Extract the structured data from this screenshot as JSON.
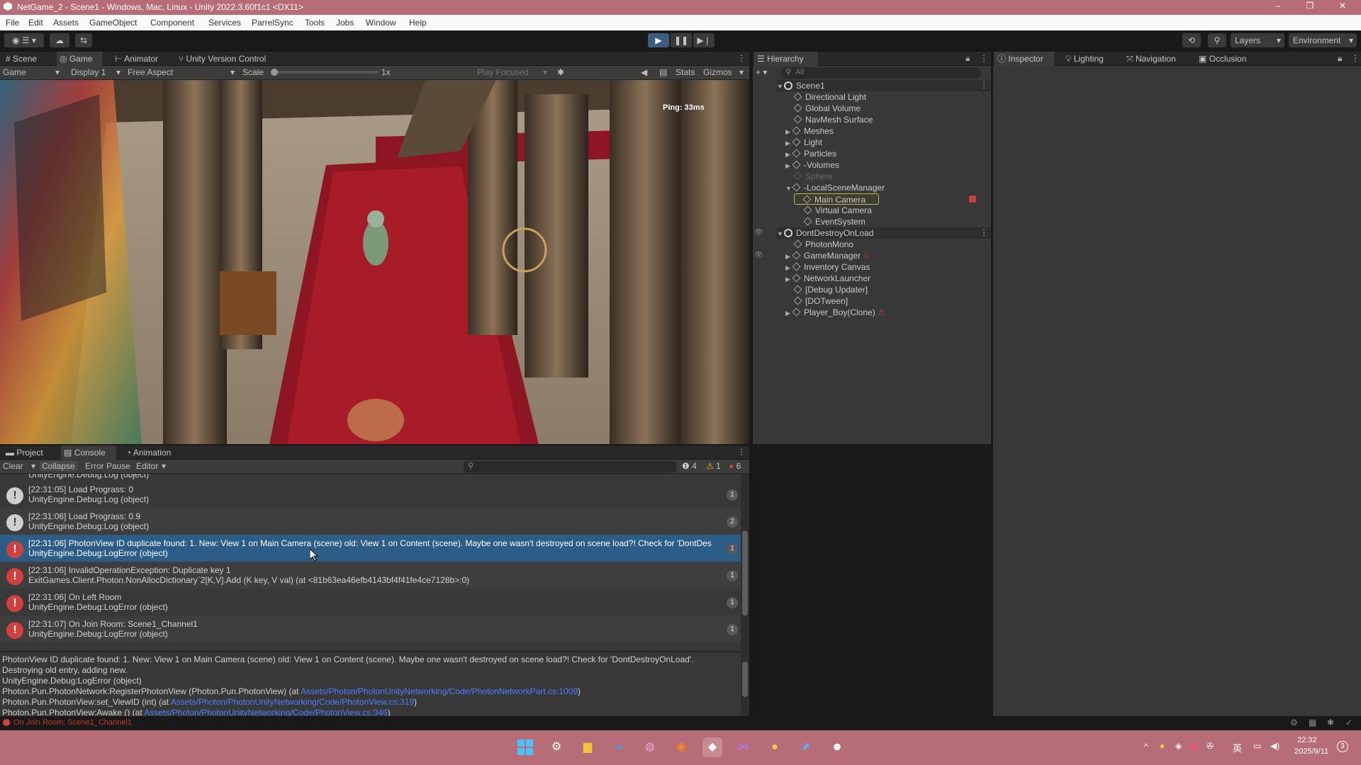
{
  "window": {
    "title": "NetGame_2 - Scene1 - Windows, Mac, Linux - Unity 2022.3.60f1c1 <DX11>",
    "min": "–",
    "max": "❐",
    "close": "✕"
  },
  "menu": [
    "File",
    "Edit",
    "Assets",
    "GameObject",
    "Component",
    "Services",
    "ParrelSync",
    "Tools",
    "Jobs",
    "Window",
    "Help"
  ],
  "toolbar": {
    "layers": "Layers",
    "environment": "Environment"
  },
  "game_panel": {
    "tabs": [
      "Scene",
      "Game",
      "Animator",
      "Unity Version Control"
    ],
    "game_label": "Game",
    "display": "Display 1",
    "aspect": "Free Aspect",
    "scale_label": "Scale",
    "scale_value": "1x",
    "play_mode": "Play Focused",
    "stats": "Stats",
    "gizmos": "Gizmos",
    "ping": "Ping: 33ms"
  },
  "hierarchy": {
    "tab": "Hierarchy",
    "search_placeholder": "All",
    "items": [
      "Scene1",
      "Directional Light",
      "Global Volume",
      "NavMesh Surface",
      "Meshes",
      "Light",
      "Particles",
      "-Volumes",
      "Sphere",
      "-LocalSceneManager",
      "Main Camera",
      "Virtual Camera",
      "EventSystem",
      "DontDestroyOnLoad",
      "PhotonMono",
      "GameManager",
      "Inventory Canvas",
      "NetworkLauncher",
      "[Debug Updater]",
      "[DOTween]",
      "Player_Boy(Clone)"
    ]
  },
  "inspector_tabs": [
    "Inspector",
    "Lighting",
    "Navigation",
    "Occlusion"
  ],
  "bottom_tabs": [
    "Project",
    "Console",
    "Animation"
  ],
  "console": {
    "clear": "Clear",
    "collapse": "Collapse",
    "error_pause": "Error Pause",
    "editor": "Editor",
    "log_count": "4",
    "warn_count": "1",
    "err_count": "6",
    "clipped_top": "UnityEngine.Debug:Log (object)",
    "entries": [
      {
        "l1": "[22:31:05] Load Prograss: 0",
        "l2": "UnityEngine.Debug:Log (object)",
        "count": "1"
      },
      {
        "l1": "[22:31:06] Load Prograss: 0.9",
        "l2": "UnityEngine.Debug:Log (object)",
        "count": "2"
      },
      {
        "l1": "[22:31:06] PhotonView ID duplicate found: 1. New: View 1 on Main Camera (scene) old: View 1 on Content (scene). Maybe one wasn't destroyed on scene load?! Check for 'DontDes",
        "l2": "UnityEngine.Debug:LogError (object)",
        "count": "1"
      },
      {
        "l1": "[22:31:06] InvalidOperationException: Duplicate key 1",
        "l2": "ExitGames.Client.Photon.NonAllocDictionary`2[K,V].Add (K key, V val) (at <81b63ea46efb4143bf4f41fe4ce7128b>:0)",
        "count": "1"
      },
      {
        "l1": "[22:31:06] On Left Room",
        "l2": "UnityEngine.Debug:LogError (object)",
        "count": "1"
      },
      {
        "l1": "[22:31:07] On Join Room: Scene1_Channel1",
        "l2": "UnityEngine.Debug:LogError (object)",
        "count": "1"
      }
    ],
    "detail": {
      "line1": "PhotonView ID duplicate found: 1. New: View 1 on Main Camera (scene) old: View 1 on Content (scene). Maybe one wasn't destroyed on scene load?! Check for 'DontDestroyOnLoad'.",
      "line2": "Destroying old entry, adding new.",
      "line3": "UnityEngine.Debug:LogError (object)",
      "line4_pre": "Photon.Pun.PhotonNetwork:RegisterPhotonView (Photon.Pun.PhotonView) (at ",
      "line4_link": "Assets/Photon/PhotonUnityNetworking/Code/PhotonNetworkPart.cs:1009",
      "line4_post": ")",
      "line5_pre": "Photon.Pun.PhotonView:set_ViewID (int) (at ",
      "line5_link": "Assets/Photon/PhotonUnityNetworking/Code/PhotonView.cs:319",
      "line5_post": ")",
      "line6_pre": "Photon.Pun.PhotonView:Awake () (at ",
      "line6_link": "Assets/Photon/PhotonUnityNetworking/Code/PhotonView.cs:346",
      "line6_post": ")"
    }
  },
  "statusbar": {
    "message": "On Join Room: Scene1_Channel1"
  },
  "taskbar": {
    "ime": "英",
    "time": "22:32",
    "date": "2025/9/11",
    "notif": "3"
  },
  "colors": {
    "title": "#b76d77",
    "error": "#d23f3f",
    "link": "#4c7eff",
    "selected": "#2c5d87"
  }
}
